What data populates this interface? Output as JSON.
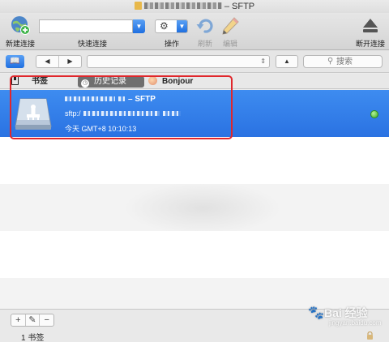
{
  "window": {
    "title": "– SFTP"
  },
  "toolbar": {
    "new_connection": "新建连接",
    "quick_connect": "快速连接",
    "quick_connect_value": "",
    "action": "操作",
    "refresh": "刷新",
    "edit": "编辑",
    "disconnect": "断开连接"
  },
  "navbar": {
    "back_glyph": "◀",
    "forward_glyph": "▶",
    "up_glyph": "▲",
    "path_value": "",
    "search_placeholder": "搜索"
  },
  "tabs": [
    {
      "label": "书签"
    },
    {
      "label": "历史记录"
    },
    {
      "label": "Bonjour"
    }
  ],
  "bookmarks": [
    {
      "nickname": "– SFTP",
      "url": "sftp:/",
      "timestamp": "今天 GMT+8 10:10:13",
      "status_color": "#3daa22"
    }
  ],
  "bottom": {
    "add": "+",
    "remove": "−",
    "count_label": "1 书签"
  },
  "watermark": {
    "brand": "Bai 经验",
    "url": "jingyan.baidu.com"
  },
  "colors": {
    "selection": "#2f7be6",
    "accent": "#1f6fe0",
    "annotation": "#e0262b"
  },
  "icons": {
    "new_connection": "globe-plus-icon",
    "refresh": "refresh-icon",
    "edit": "pencil-icon",
    "disconnect": "eject-icon",
    "bookmark_item": "network-drive-icon"
  }
}
